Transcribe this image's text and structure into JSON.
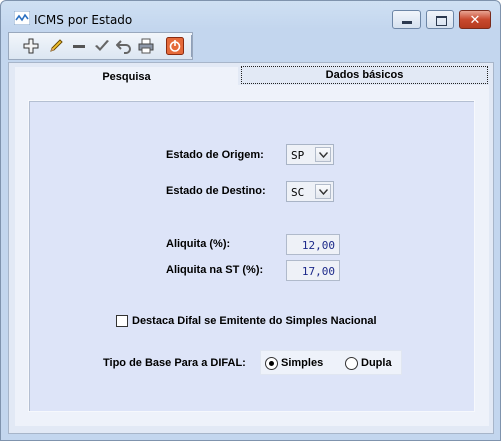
{
  "window": {
    "title": "ICMS por Estado",
    "close_glyph": "✕"
  },
  "icons": {
    "app": "chart-line-icon",
    "toolbar": [
      "add-icon",
      "edit-pencil-icon",
      "remove-icon",
      "confirm-check-icon",
      "undo-icon",
      "print-icon",
      "power-exit-icon"
    ]
  },
  "tabs": [
    {
      "label": "Pesquisa"
    },
    {
      "label": "Dados básicos"
    }
  ],
  "form": {
    "origem_label": "Estado de Origem:",
    "origem_value": "SP",
    "destino_label": "Estado de Destino:",
    "destino_value": "SC",
    "aliquota_label": "Aliquita (%):",
    "aliquota_value": "12,00",
    "aliquota_st_label": "Aliquita na ST (%):",
    "aliquota_st_value": "17,00",
    "difal_check_label": "Destaca Difal se Emitente do Simples Nacional",
    "difal_checked": false,
    "base_label": "Tipo de Base Para a DIFAL:",
    "base_options": [
      "Simples",
      "Dupla"
    ],
    "base_selected": "Simples"
  },
  "colors": {
    "close_button": "#c8492e",
    "field_text": "#1d2a8a",
    "panel_bg": "#dde4f8"
  }
}
